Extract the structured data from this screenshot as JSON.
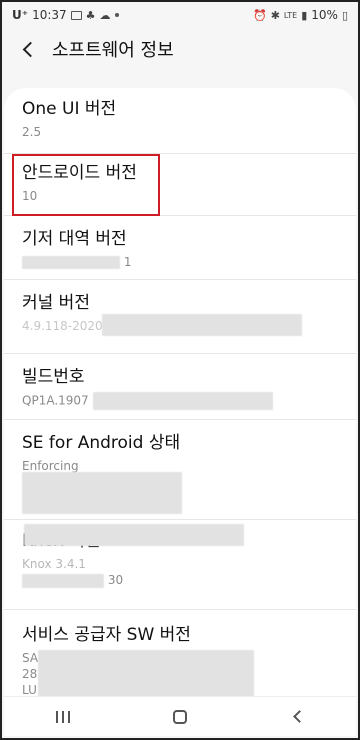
{
  "status_bar": {
    "carrier": "U⁺",
    "time": "10:37",
    "network": "LTE",
    "battery": "10%"
  },
  "header": {
    "title": "소프트웨어 정보"
  },
  "highlight_color": "#d01c24",
  "items": [
    {
      "title": "One UI 버전",
      "sub": "2.5"
    },
    {
      "title": "안드로이드 버전",
      "sub": "10"
    },
    {
      "title": "기저 대역 버전",
      "sub": "1"
    },
    {
      "title": "커널 버전",
      "sub": "4.9.118-20200768"
    },
    {
      "title": "빌드번호",
      "sub": "QP1A.1907"
    },
    {
      "title": "SE for Android 상태",
      "sub": "Enforcing"
    },
    {
      "title": "Knox 버전",
      "sub": "Knox 3.4.1",
      "sub2": "30"
    },
    {
      "title": "서비스 공급자 SW 버전",
      "sub": "SA",
      "sub2": "28",
      "sub3": "LU"
    }
  ]
}
